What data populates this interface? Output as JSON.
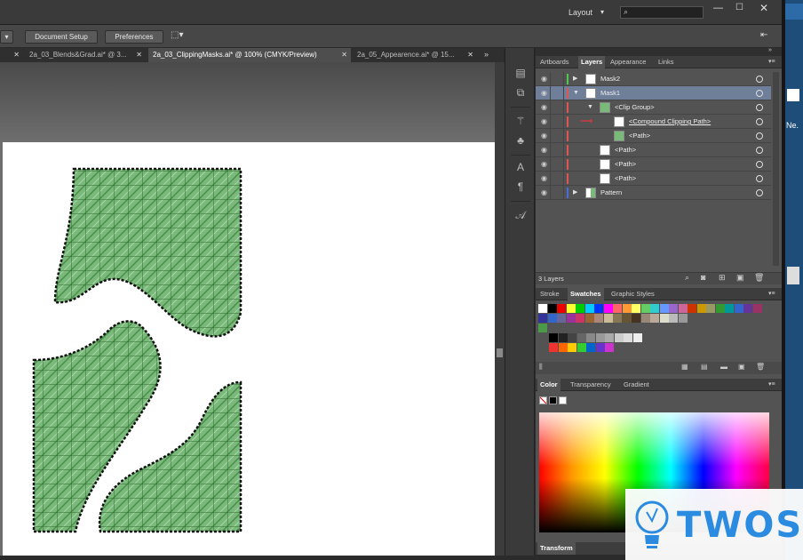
{
  "appbar": {
    "workspace_label": "Layout"
  },
  "controlbar": {
    "document_setup": "Document Setup",
    "preferences": "Preferences"
  },
  "doc_tabs": [
    {
      "label": "2a_03_Blends&Grad.ai* @ 3..."
    },
    {
      "label": "2a_03_ClippingMasks.ai* @ 100% (CMYK/Preview)"
    },
    {
      "label": "2a_05_Appearence.ai* @ 15..."
    }
  ],
  "layers_panel": {
    "tabs": [
      "Artboards",
      "Layers",
      "Appearance",
      "Links"
    ],
    "rows": [
      {
        "label": "Mask2",
        "color": "#4ec94e"
      },
      {
        "label": "Mask1",
        "color": "#e05454"
      },
      {
        "label": "<Clip Group>",
        "color": "#e05454"
      },
      {
        "label": "<Compound Clipping Path>",
        "color": "#e05454"
      },
      {
        "label": "<Path>",
        "color": "#e05454"
      },
      {
        "label": "<Path>",
        "color": "#e05454"
      },
      {
        "label": "<Path>",
        "color": "#e05454"
      },
      {
        "label": "<Path>",
        "color": "#e05454"
      },
      {
        "label": "Pattern",
        "color": "#4a6cd8"
      }
    ],
    "count_text": "3 Layers"
  },
  "swatches_panel": {
    "tabs": [
      "Stroke",
      "Swatches",
      "Graphic Styles"
    ]
  },
  "color_panel": {
    "tabs": [
      "Color",
      "Transparency",
      "Gradient"
    ]
  },
  "transform_panel": {
    "tab": "Transform"
  },
  "edge_label": "Ne.",
  "watermark": {
    "text": "TWOS"
  },
  "colors": {
    "highlight_row": "#6f7f99",
    "artwork_fill": "#6fb06f",
    "accent": "#2a8be0"
  }
}
